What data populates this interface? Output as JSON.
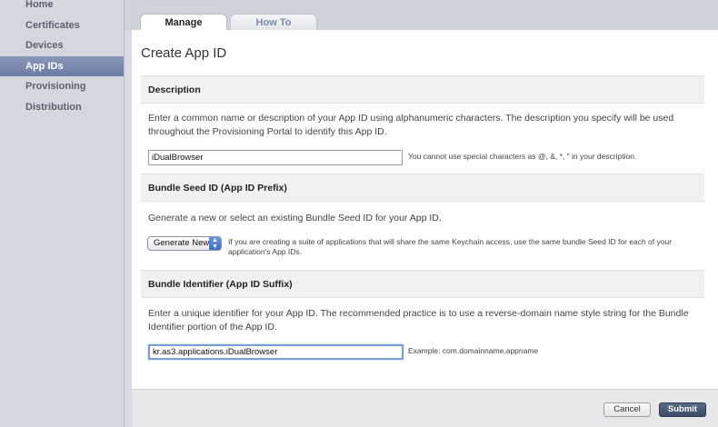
{
  "sidebar": {
    "items": [
      {
        "label": "Home"
      },
      {
        "label": "Certificates"
      },
      {
        "label": "Devices"
      },
      {
        "label": "App IDs",
        "active": true
      },
      {
        "label": "Provisioning"
      },
      {
        "label": "Distribution"
      }
    ]
  },
  "tabs": {
    "manage": "Manage",
    "howto": "How To"
  },
  "page": {
    "title": "Create App ID"
  },
  "description": {
    "header": "Description",
    "text": "Enter a common name or description of your App ID using alphanumeric characters. The description you specify will be used throughout the Provisioning Portal to identify this App ID.",
    "value": "iDualBrowser",
    "hint": "You cannot use special characters as @, &, *, \" in your description."
  },
  "seed": {
    "header": "Bundle Seed ID (App ID Prefix)",
    "text": "Generate a new or select an existing Bundle Seed ID for your App ID.",
    "selected": "Generate New",
    "hint": "If you are creating a suite of applications that will share the same Keychain access, use the same bundle Seed ID for each of your application's App IDs."
  },
  "bundle": {
    "header": "Bundle Identifier (App ID Suffix)",
    "text": "Enter a unique identifier for your App ID. The recommended practice is to use a reverse-domain name style string for the Bundle Identifier portion of the App ID.",
    "value": "kr.as3.applications.iDualBrowser",
    "hint": "Example: com.domainname.appname"
  },
  "footer": {
    "cancel": "Cancel",
    "submit": "Submit"
  }
}
